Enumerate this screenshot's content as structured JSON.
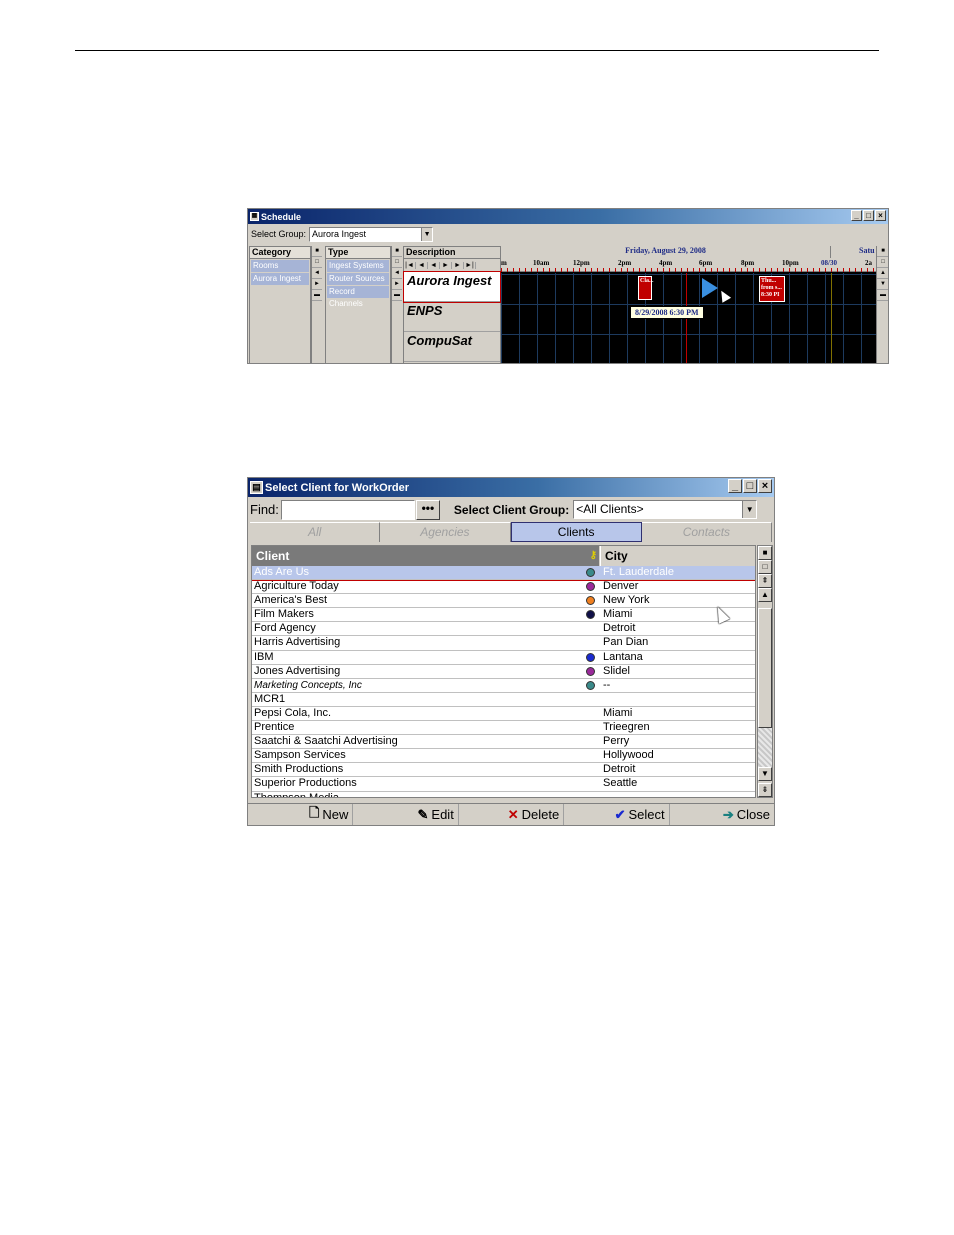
{
  "schedule": {
    "title": "Schedule",
    "window_buttons": [
      "_",
      "□",
      "×"
    ],
    "select_group_label": "Select Group:",
    "select_group_value": "Aurora Ingest",
    "category": {
      "header": "Category",
      "items": [
        "Rooms",
        "Aurora Ingest"
      ]
    },
    "type": {
      "header": "Type",
      "items": [
        "Ingest Systems",
        "Router Sources",
        "Record Channels"
      ]
    },
    "description": {
      "header": "Description",
      "resources": [
        "Aurora Ingest",
        "ENPS",
        "CompuSat"
      ]
    },
    "timeline": {
      "date": "Friday, August 29, 2008",
      "next_date": "Satu",
      "ticks": [
        "m",
        "10am",
        "12pm",
        "2pm",
        "4pm",
        "6pm",
        "8pm",
        "10pm",
        "08/30",
        "2a"
      ],
      "event_left": "Cla...",
      "event_right": "Thu... from s... 8:30 PI",
      "tooltip": "8/29/2008 6:30 PM"
    }
  },
  "client_dialog": {
    "title": "Select Client for WorkOrder",
    "find_label": "Find:",
    "find_value": "",
    "dots_label": "•••",
    "group_label": "Select Client Group:",
    "group_value": "<All Clients>",
    "tabs": [
      {
        "label": "All",
        "active": false
      },
      {
        "label": "Agencies",
        "active": false
      },
      {
        "label": "Clients",
        "active": true
      },
      {
        "label": "Contacts",
        "active": false
      }
    ],
    "columns": {
      "client": "Client",
      "city": "City"
    },
    "rows": [
      {
        "client": "Ads Are Us",
        "dot": "#3a8a8a",
        "city": "Ft. Lauderdale",
        "selected": true
      },
      {
        "client": "Agriculture Today",
        "dot": "#9a2a9a",
        "city": "Denver"
      },
      {
        "client": "America's Best",
        "dot": "#f08020",
        "city": "New York"
      },
      {
        "client": "Film Makers",
        "dot": "#101048",
        "city": "Miami"
      },
      {
        "client": "Ford Agency",
        "dot": "",
        "city": "Detroit"
      },
      {
        "client": "Harris Advertising",
        "dot": "",
        "city": "Pan Dian"
      },
      {
        "client": "IBM",
        "dot": "#1a2ad0",
        "city": "Lantana"
      },
      {
        "client": "Jones Advertising",
        "dot": "#9a2a9a",
        "city": "Slidel"
      },
      {
        "client": "Marketing Concepts, Inc",
        "dot": "#3a8a8a",
        "city": "--",
        "italic": true
      },
      {
        "client": "MCR1",
        "dot": "",
        "city": ""
      },
      {
        "client": "Pepsi Cola, Inc.",
        "dot": "",
        "city": "Miami"
      },
      {
        "client": "Prentice",
        "dot": "",
        "city": "Trieegren"
      },
      {
        "client": "Saatchi & Saatchi Advertising",
        "dot": "",
        "city": "Perry"
      },
      {
        "client": "Sampson Services",
        "dot": "",
        "city": "Hollywood"
      },
      {
        "client": "Smith Productions",
        "dot": "",
        "city": "Detroit"
      },
      {
        "client": "Superior Productions",
        "dot": "",
        "city": "Seattle"
      },
      {
        "client": "Thompson Media",
        "dot": "",
        "city": ""
      }
    ],
    "actions": [
      {
        "label": "New",
        "icon": "new-document-icon",
        "glyph": "🗋",
        "color": "#000000"
      },
      {
        "label": "Edit",
        "icon": "pencil-icon",
        "glyph": "✎",
        "color": "#000000"
      },
      {
        "label": "Delete",
        "icon": "delete-x-icon",
        "glyph": "✕",
        "color": "#c00000"
      },
      {
        "label": "Select",
        "icon": "checkmark-icon",
        "glyph": "✔",
        "color": "#1a2ad0"
      },
      {
        "label": "Close",
        "icon": "exit-door-icon",
        "glyph": "➔",
        "color": "#1a8080"
      }
    ]
  }
}
